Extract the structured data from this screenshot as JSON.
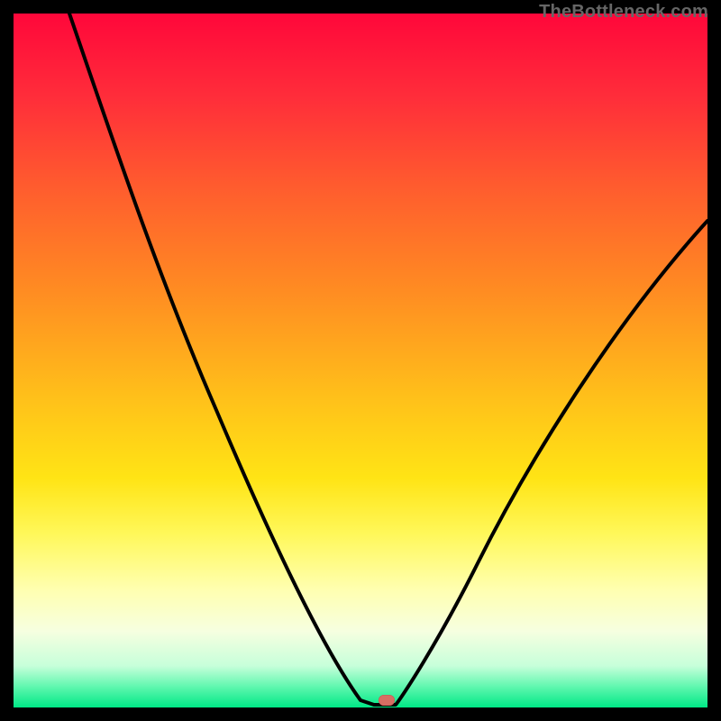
{
  "attribution": "TheBottleneck.com",
  "chart_data": {
    "type": "line",
    "title": "",
    "xlabel": "",
    "ylabel": "",
    "xlim": [
      0,
      100
    ],
    "ylim": [
      0,
      100
    ],
    "curve": [
      {
        "x": 8,
        "y": 100
      },
      {
        "x": 15,
        "y": 80
      },
      {
        "x": 23,
        "y": 60
      },
      {
        "x": 32,
        "y": 40
      },
      {
        "x": 40,
        "y": 20
      },
      {
        "x": 46,
        "y": 7
      },
      {
        "x": 50,
        "y": 1
      },
      {
        "x": 52,
        "y": 0
      },
      {
        "x": 55,
        "y": 0
      },
      {
        "x": 57,
        "y": 1
      },
      {
        "x": 64,
        "y": 12
      },
      {
        "x": 72,
        "y": 25
      },
      {
        "x": 80,
        "y": 38
      },
      {
        "x": 88,
        "y": 51
      },
      {
        "x": 95,
        "y": 62
      },
      {
        "x": 100,
        "y": 70
      }
    ],
    "marker": {
      "x": 54,
      "y": 0
    },
    "colors": {
      "curve": "#000000",
      "gradient_top": "#ff073a",
      "gradient_bottom": "#00e886",
      "marker": "#d66e63"
    }
  }
}
